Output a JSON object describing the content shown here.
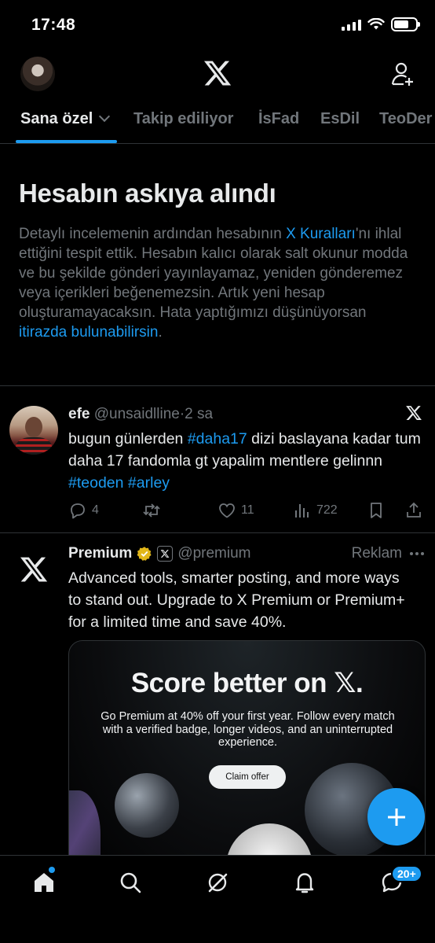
{
  "status_bar": {
    "time": "17:48"
  },
  "header": {
    "logo_icon": "x-logo-icon",
    "add_user_icon": "add-user-icon"
  },
  "tabs": [
    {
      "label": "Sana özel",
      "active": true
    },
    {
      "label": "Takip ediliyor"
    },
    {
      "label": "İsFad"
    },
    {
      "label": "EsDil"
    },
    {
      "label": "TeoDer"
    }
  ],
  "notice": {
    "title": "Hesabın askıya alındı",
    "body_1": "Detaylı incelemenin ardından hesabının ",
    "link_1": "X Kuralları",
    "body_2": "'nı ihlal ettiğini tespit ettik. Hesabın kalıcı olarak salt okunur modda ve bu şekilde gönderi yayınlayamaz, yeniden gönderemez veya içerikleri beğenemezsin. Artık yeni hesap oluşturamayacaksın. Hata yaptığımızı düşünüyorsan ",
    "link_2": "itirazda bulunabilirsin",
    "body_3": "."
  },
  "post": {
    "name": "efe",
    "handle": "@unsaidlline",
    "separator": "·",
    "time": "2 sa",
    "text_1": "bugun günlerden ",
    "hashtag_1": "#daha17",
    "text_2": " dizi baslayana kadar tum daha 17 fandomla gt yapalim mentlere gelinnn ",
    "hashtag_2": "#teoden",
    "space": " ",
    "hashtag_3": "#arley",
    "replies": "4",
    "reposts": "",
    "likes": "11",
    "views": "722"
  },
  "ad": {
    "name": "Premium",
    "handle": "@premium",
    "label": "Reklam",
    "text": "Advanced tools, smarter posting, and more ways to stand out. Upgrade to X Premium or Premium+ for a limited time and save 40%.",
    "promo_title": "Score better on 𝕏.",
    "promo_sub": "Go Premium at 40% off your first year. Follow every match with a verified badge, longer videos, and an uninterrupted experience.",
    "cta": "Claim offer"
  },
  "bottom_nav": {
    "items": [
      "home-icon",
      "search-icon",
      "grok-icon",
      "notifications-icon",
      "messages-icon"
    ],
    "messages_badge": "20+"
  },
  "colors": {
    "accent": "#1d9bf0",
    "muted": "#71767b",
    "text": "#e7e9ea",
    "border": "#2f3336"
  }
}
